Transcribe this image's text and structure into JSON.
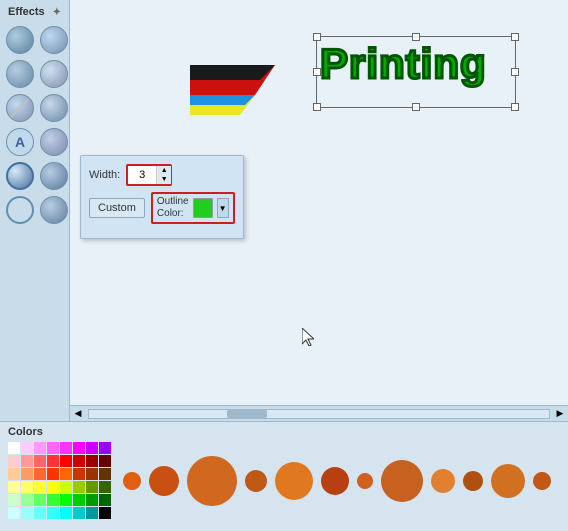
{
  "effects_panel": {
    "title": "Effects",
    "pin_symbol": "✦"
  },
  "popup": {
    "width_label": "Width:",
    "width_value": "3",
    "custom_label": "Custom",
    "outline_color_label": "Outline\nColor:"
  },
  "printing_text": "Printing",
  "colors_panel": {
    "title": "Colors"
  },
  "color_grid": [
    "#ffffff",
    "#ffccff",
    "#ff99ff",
    "#ff66ff",
    "#ff33ff",
    "#ff00ff",
    "#cc00ff",
    "#9900ff",
    "#ffcccc",
    "#ff9999",
    "#ff6666",
    "#ff3333",
    "#ff0000",
    "#cc0000",
    "#990000",
    "#660000",
    "#ffcc99",
    "#ff9966",
    "#ff6633",
    "#ff3300",
    "#ff6600",
    "#cc3300",
    "#993300",
    "#663300",
    "#ffff99",
    "#ffff66",
    "#ffff33",
    "#ffff00",
    "#ccff00",
    "#99cc00",
    "#669900",
    "#336600",
    "#ccffcc",
    "#99ff99",
    "#66ff66",
    "#33ff33",
    "#00ff00",
    "#00cc00",
    "#009900",
    "#006600",
    "#ccffff",
    "#99ffff",
    "#66ffff",
    "#33ffff",
    "#00ffff",
    "#00cccc",
    "#009999",
    "#000000"
  ],
  "circles": [
    {
      "size": 18,
      "color": "#e06010"
    },
    {
      "size": 30,
      "color": "#c85010"
    },
    {
      "size": 50,
      "color": "#d06820"
    },
    {
      "size": 22,
      "color": "#c05818"
    },
    {
      "size": 38,
      "color": "#e07820"
    },
    {
      "size": 28,
      "color": "#b84010"
    },
    {
      "size": 16,
      "color": "#d06020"
    },
    {
      "size": 42,
      "color": "#c86020"
    },
    {
      "size": 24,
      "color": "#e08030"
    },
    {
      "size": 20,
      "color": "#b05010"
    },
    {
      "size": 34,
      "color": "#d07020"
    },
    {
      "size": 18,
      "color": "#c05818"
    }
  ]
}
